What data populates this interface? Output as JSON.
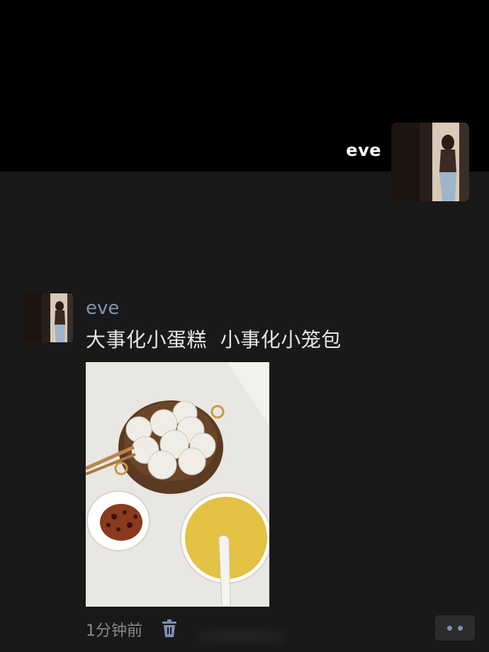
{
  "cover": {
    "user_name": "eve"
  },
  "post": {
    "author": "eve",
    "text": "大事化小蛋糕  小事化小笼包",
    "time": "1分钟前"
  },
  "icons": {
    "delete": "trash-icon",
    "more": "more-dots-icon"
  },
  "colors": {
    "background": "#191919",
    "cover": "#000000",
    "author_link": "#8294b3"
  }
}
